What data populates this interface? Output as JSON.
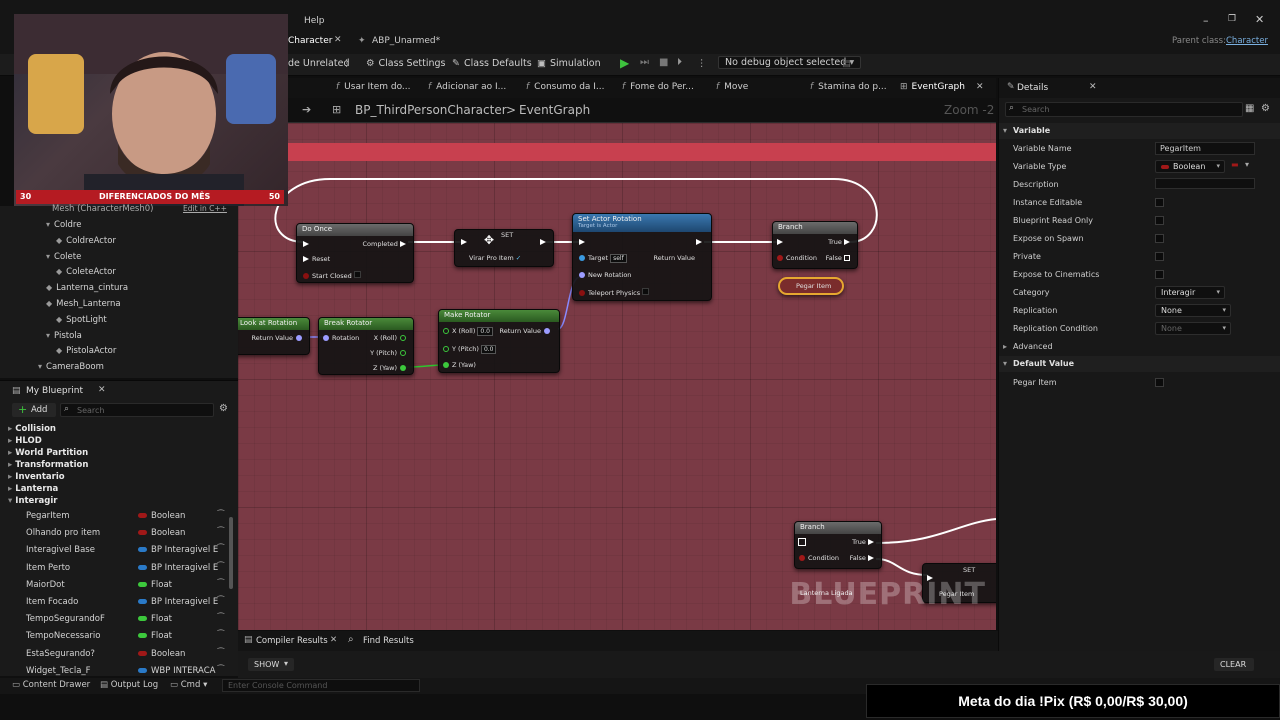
{
  "menubar": {
    "help": "Help",
    "parent_class_label": "Parent class:",
    "parent_class_value": "Character"
  },
  "tabs": {
    "character": "Character",
    "abp": "ABP_Unarmed*"
  },
  "toolbar": {
    "hide_unrelated": "de Unrelated",
    "class_settings": "Class Settings",
    "class_defaults": "Class Defaults",
    "simulation": "Simulation",
    "debug_select": "No debug object selected"
  },
  "graph_tabs": [
    "Usar Item do...",
    "Adicionar ao I...",
    "Consumo da I...",
    "Fome do Per...",
    "Move",
    "Stamina do p...",
    "EventGraph"
  ],
  "breadcrumb": {
    "root": "BP_ThirdPersonCharacter",
    "sep": ">",
    "graph": "EventGraph",
    "zoom": "Zoom -2"
  },
  "graph": {
    "watermark": "BLUEPRINT",
    "nodes": {
      "do_once": {
        "title": "Do Once",
        "completed": "Completed",
        "reset": "Reset",
        "start_closed": "Start Closed"
      },
      "set1": {
        "title": "SET",
        "var": "Virar Pro Item"
      },
      "set_actor_rotation": {
        "title": "Set Actor Rotation",
        "subtitle": "Target is Actor",
        "target": "Target",
        "self": "self",
        "return_value": "Return Value",
        "new_rotation": "New Rotation",
        "teleport": "Teleport Physics"
      },
      "branch1": {
        "title": "Branch",
        "true_label": "True",
        "condition": "Condition",
        "false_label": "False"
      },
      "pegar_item_getter": "Pegar Item",
      "look_at": {
        "title": "Look at Rotation",
        "return_value": "Return Value"
      },
      "break_rotator": {
        "title": "Break Rotator",
        "rotation": "Rotation",
        "x": "X (Roll)",
        "y": "Y (Pitch)",
        "z": "Z (Yaw)"
      },
      "make_rotator": {
        "title": "Make Rotator",
        "x": "X (Roll)",
        "y": "Y (Pitch)",
        "z": "Z (Yaw)",
        "xv": "0.0",
        "yv": "0.0",
        "return_value": "Return Value"
      },
      "branch2": {
        "title": "Branch",
        "true_label": "True",
        "condition": "Condition",
        "false_label": "False"
      },
      "set2": {
        "title": "SET",
        "var": "Pegar Item"
      },
      "lanterna_ligada": "Lanterna Ligada"
    }
  },
  "webcam": {
    "left": "30",
    "label": "DIFERENCIADOS DO MÊS",
    "right": "50"
  },
  "components": {
    "mesh": "Mesh (CharacterMesh0)",
    "edit_cpp": "Edit in C++",
    "items": [
      {
        "label": "Coldre",
        "indent": 1,
        "icon": "▾"
      },
      {
        "label": "ColdreActor",
        "indent": 2,
        "icon": "◆"
      },
      {
        "label": "Colete",
        "indent": 1,
        "icon": "▾"
      },
      {
        "label": "ColeteActor",
        "indent": 2,
        "icon": "◆"
      },
      {
        "label": "Lanterna_cintura",
        "indent": 1,
        "icon": "◆"
      },
      {
        "label": "Mesh_Lanterna",
        "indent": 1,
        "icon": "◆"
      },
      {
        "label": "SpotLight",
        "indent": 2,
        "icon": "◆"
      },
      {
        "label": "Pistola",
        "indent": 1,
        "icon": "▾"
      },
      {
        "label": "PistolaActor",
        "indent": 2,
        "icon": "◆"
      },
      {
        "label": "CameraBoom",
        "indent": 0,
        "icon": "▾"
      }
    ]
  },
  "my_blueprint": {
    "title": "My Blueprint",
    "add": "Add",
    "search_placeholder": "Search",
    "categories": [
      "Collision",
      "HLOD",
      "World Partition",
      "Transformation",
      "Inventario",
      "Lanterna",
      "Interagir"
    ],
    "variables": [
      {
        "name": "PegarItem",
        "type": "Boolean",
        "color": "#a01818"
      },
      {
        "name": "Olhando pro item",
        "type": "Boolean",
        "color": "#a01818"
      },
      {
        "name": "Interagivel Base",
        "type": "BP Interagivel E",
        "color": "#2a7ac8"
      },
      {
        "name": "Item Perto",
        "type": "BP Interagivel E",
        "color": "#2a7ac8"
      },
      {
        "name": "MaiorDot",
        "type": "Float",
        "color": "#3cc83c"
      },
      {
        "name": "Item Focado",
        "type": "BP Interagivel E",
        "color": "#2a7ac8"
      },
      {
        "name": "TempoSegurandoF",
        "type": "Float",
        "color": "#3cc83c"
      },
      {
        "name": "TempoNecessario",
        "type": "Float",
        "color": "#3cc83c"
      },
      {
        "name": "EstaSegurando?",
        "type": "Boolean",
        "color": "#a01818"
      },
      {
        "name": "Widget_Tecla_F",
        "type": "WBP INTERACA",
        "color": "#2a7ac8"
      }
    ]
  },
  "details": {
    "title": "Details",
    "search_placeholder": "Search",
    "section_variable": "Variable",
    "variable_name_label": "Variable Name",
    "variable_name_value": "PegarItem",
    "variable_type_label": "Variable Type",
    "variable_type_value": "Boolean",
    "description_label": "Description",
    "instance_editable": "Instance Editable",
    "bp_read_only": "Blueprint Read Only",
    "expose_spawn": "Expose on Spawn",
    "private": "Private",
    "expose_cinematics": "Expose to Cinematics",
    "category_label": "Category",
    "category_value": "Interagir",
    "replication_label": "Replication",
    "replication_value": "None",
    "replication_condition_label": "Replication Condition",
    "replication_condition_value": "None",
    "advanced": "Advanced",
    "default_value": "Default Value",
    "pegar_item": "Pegar Item"
  },
  "bottom": {
    "compiler_results": "Compiler Results",
    "find_results": "Find Results",
    "show": "SHOW",
    "clear": "CLEAR"
  },
  "statusbar": {
    "content_drawer": "Content Drawer",
    "output_log": "Output Log",
    "cmd": "Cmd",
    "console_placeholder": "Enter Console Command"
  },
  "overlay": {
    "meta": "Meta do dia !Pix (R$ 0,00/R$ 30,00)"
  }
}
